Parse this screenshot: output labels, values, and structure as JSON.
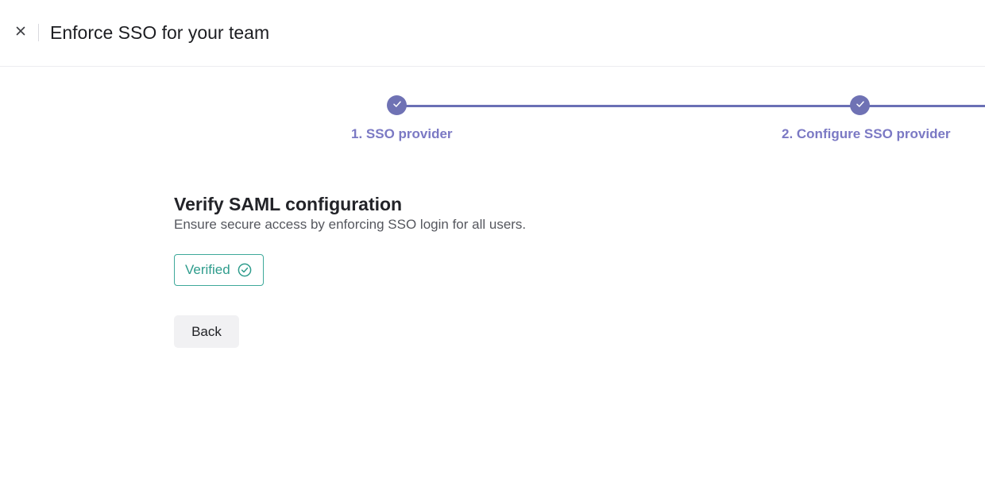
{
  "header": {
    "title": "Enforce SSO for your team",
    "close_icon": "close-icon"
  },
  "stepper": {
    "accent_color": "#6f72b4",
    "steps": [
      {
        "label": "1. SSO provider",
        "status": "complete",
        "icon": "checkmark-icon"
      },
      {
        "label": "2. Configure SSO provider",
        "status": "complete",
        "icon": "checkmark-icon"
      }
    ]
  },
  "main": {
    "title": "Verify SAML configuration",
    "description": "Ensure secure access by enforcing SSO login for all users.",
    "verified_button": {
      "label": "Verified",
      "icon": "check-circle-icon",
      "color": "#2e9c8c"
    },
    "back_button": {
      "label": "Back"
    }
  }
}
